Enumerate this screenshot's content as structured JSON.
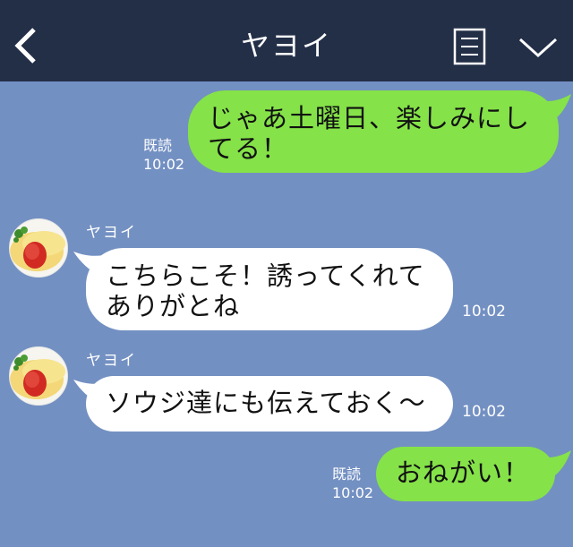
{
  "header": {
    "title": "ヤヨイ",
    "bg_color": "#232f47"
  },
  "colors": {
    "background": "#7390c2",
    "outgoing_bubble": "#85e249",
    "incoming_bubble": "#ffffff"
  },
  "messages": [
    {
      "direction": "outgoing",
      "lines": [
        "じゃあ土曜日、楽しみにし",
        "てる！"
      ],
      "read_label": "既読",
      "time": "10:02"
    },
    {
      "direction": "incoming",
      "sender": "ヤヨイ",
      "lines": [
        "こちらこそ！誘ってくれて",
        "ありがとね"
      ],
      "time": "10:02"
    },
    {
      "direction": "incoming",
      "sender": "ヤヨイ",
      "lines": [
        "ソウジ達にも伝えておく〜"
      ],
      "time": "10:02"
    },
    {
      "direction": "outgoing",
      "lines": [
        "おねがい！"
      ],
      "read_label": "既読",
      "time": "10:02"
    }
  ],
  "icons": {
    "back": "chevron-left-icon",
    "note": "note-icon",
    "menu": "chevron-down-icon",
    "avatar": "omelette-rice-avatar"
  }
}
